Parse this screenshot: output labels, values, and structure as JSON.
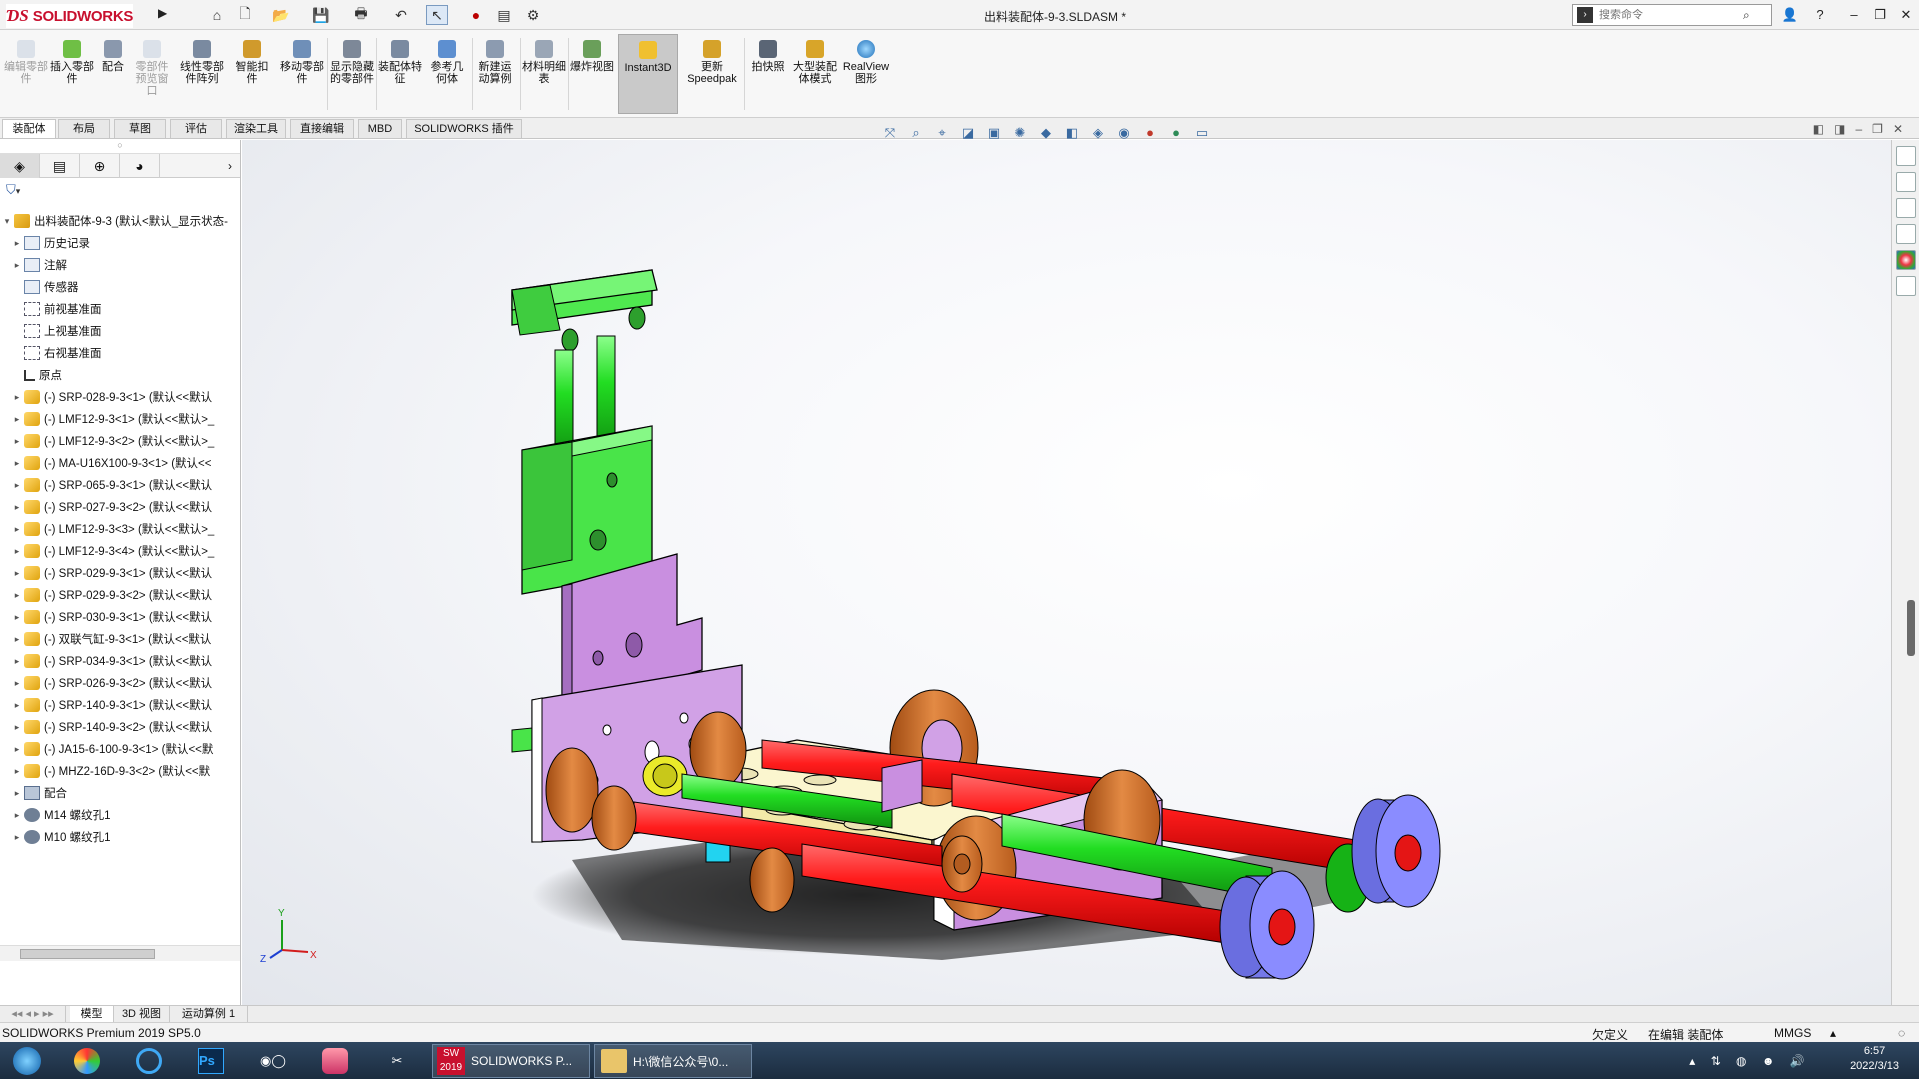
{
  "app": {
    "logo": "SOLIDWORKS",
    "document_title": "出料装配体-9-3.SLDASM *",
    "search_placeholder": "搜索命令"
  },
  "ribbon": {
    "buttons": [
      {
        "label": "编辑零部件",
        "disabled": true
      },
      {
        "label": "插入零部件",
        "disabled": false
      },
      {
        "label": "配合",
        "disabled": false
      },
      {
        "label": "零部件预览窗口",
        "disabled": true
      },
      {
        "label": "线性零部件阵列",
        "disabled": false
      },
      {
        "label": "智能扣件",
        "disabled": false
      },
      {
        "label": "移动零部件",
        "disabled": false
      },
      {
        "label": "显示隐藏的零部件",
        "disabled": false
      },
      {
        "label": "装配体特征",
        "disabled": false
      },
      {
        "label": "参考几何体",
        "disabled": false
      },
      {
        "label": "新建运动算例",
        "disabled": false
      },
      {
        "label": "材料明细表",
        "disabled": false
      },
      {
        "label": "爆炸视图",
        "disabled": false
      },
      {
        "label": "Instant3D",
        "disabled": false
      },
      {
        "label": "更新Speedpak",
        "disabled": false
      },
      {
        "label": "拍快照",
        "disabled": false
      },
      {
        "label": "大型装配体模式",
        "disabled": false
      },
      {
        "label": "RealView图形",
        "disabled": false
      }
    ]
  },
  "command_tabs": [
    "装配体",
    "布局",
    "草图",
    "评估",
    "渲染工具",
    "直接编辑",
    "MBD",
    "SOLIDWORKS 插件"
  ],
  "tree": {
    "root": "出料装配体-9-3  (默认<默认_显示状态-",
    "items": [
      {
        "label": "历史记录",
        "icon": "folder",
        "expand": true
      },
      {
        "label": "注解",
        "icon": "folder",
        "expand": true
      },
      {
        "label": "传感器",
        "icon": "folder",
        "expand": false
      },
      {
        "label": "前视基准面",
        "icon": "plane",
        "expand": false
      },
      {
        "label": "上视基准面",
        "icon": "plane",
        "expand": false
      },
      {
        "label": "右视基准面",
        "icon": "plane",
        "expand": false
      },
      {
        "label": "原点",
        "icon": "origin",
        "expand": false
      },
      {
        "label": "(-) SRP-028-9-3<1> (默认<<默认",
        "icon": "part",
        "expand": true
      },
      {
        "label": "(-) LMF12-9-3<1> (默认<<默认>_",
        "icon": "part",
        "expand": true
      },
      {
        "label": "(-) LMF12-9-3<2> (默认<<默认>_",
        "icon": "part",
        "expand": true
      },
      {
        "label": "(-) MA-U16X100-9-3<1> (默认<<",
        "icon": "part",
        "expand": true
      },
      {
        "label": "(-) SRP-065-9-3<1> (默认<<默认",
        "icon": "part",
        "expand": true
      },
      {
        "label": "(-) SRP-027-9-3<2> (默认<<默认",
        "icon": "part",
        "expand": true
      },
      {
        "label": "(-) LMF12-9-3<3> (默认<<默认>_",
        "icon": "part",
        "expand": true
      },
      {
        "label": "(-) LMF12-9-3<4> (默认<<默认>_",
        "icon": "part",
        "expand": true
      },
      {
        "label": "(-) SRP-029-9-3<1> (默认<<默认",
        "icon": "part",
        "expand": true
      },
      {
        "label": "(-) SRP-029-9-3<2> (默认<<默认",
        "icon": "part",
        "expand": true
      },
      {
        "label": "(-) SRP-030-9-3<1> (默认<<默认",
        "icon": "part",
        "expand": true
      },
      {
        "label": "(-) 双联气缸-9-3<1> (默认<<默认",
        "icon": "part",
        "expand": true
      },
      {
        "label": "(-) SRP-034-9-3<1> (默认<<默认",
        "icon": "part",
        "expand": true
      },
      {
        "label": "(-) SRP-026-9-3<2> (默认<<默认",
        "icon": "part",
        "expand": true
      },
      {
        "label": "(-) SRP-140-9-3<1> (默认<<默认",
        "icon": "part",
        "expand": true
      },
      {
        "label": "(-) SRP-140-9-3<2> (默认<<默认",
        "icon": "part",
        "expand": true
      },
      {
        "label": "(-) JA15-6-100-9-3<1> (默认<<默",
        "icon": "part",
        "expand": true
      },
      {
        "label": "(-) MHZ2-16D-9-3<2> (默认<<默",
        "icon": "part",
        "expand": true
      },
      {
        "label": "配合",
        "icon": "mate",
        "expand": true
      },
      {
        "label": "M14 螺纹孔1",
        "icon": "hole",
        "expand": true
      },
      {
        "label": "M10 螺纹孔1",
        "icon": "hole",
        "expand": true
      }
    ]
  },
  "bottom_tabs": [
    "模型",
    "3D 视图",
    "运动算例 1"
  ],
  "status": {
    "version": "SOLIDWORKS Premium 2019 SP5.0",
    "definition": "欠定义",
    "editing": "在编辑 装配体",
    "units": "MMGS"
  },
  "triad": {
    "x": "X",
    "y": "Y",
    "z": "Z"
  },
  "taskbar": {
    "apps": [
      {
        "label": "SOLIDWORKS P...",
        "badge": "2019"
      },
      {
        "label": "H:\\微信公众号\\0..."
      }
    ],
    "time": "6:57",
    "date": "2022/3/13"
  },
  "colors": {
    "green_part": "#4fe84f",
    "lilac_part": "#c98fe0",
    "red_shaft": "#f21a1a",
    "blue_cap": "#8a8cff",
    "orange_flange": "#d8712a",
    "base_plate": "#fbf6cf",
    "accent_red": "#c8102e"
  }
}
